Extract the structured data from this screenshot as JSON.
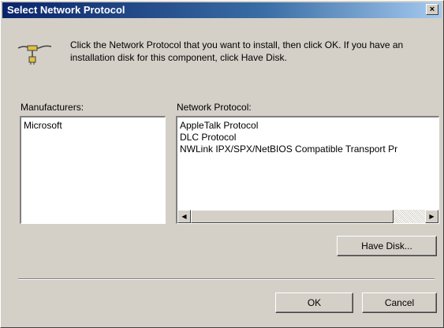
{
  "dialog": {
    "title": "Select Network Protocol",
    "close_label": "×",
    "instructions": "Click the Network Protocol that you want to install, then click OK. If you have an installation disk for this component, click Have Disk."
  },
  "manufacturers": {
    "label": "Manufacturers:",
    "items": [
      "Microsoft"
    ]
  },
  "protocols": {
    "label": "Network Protocol:",
    "items": [
      "AppleTalk Protocol",
      "DLC Protocol",
      "NWLink IPX/SPX/NetBIOS Compatible Transport Pr"
    ],
    "scroll_left": "◀",
    "scroll_right": "▶"
  },
  "buttons": {
    "have_disk": "Have Disk...",
    "ok": "OK",
    "cancel": "Cancel"
  },
  "colors": {
    "titlebar_start": "#0a246a",
    "titlebar_end": "#a6caf0",
    "face": "#d4d0c8"
  },
  "icons": {
    "protocol": "network-cable-icon"
  }
}
